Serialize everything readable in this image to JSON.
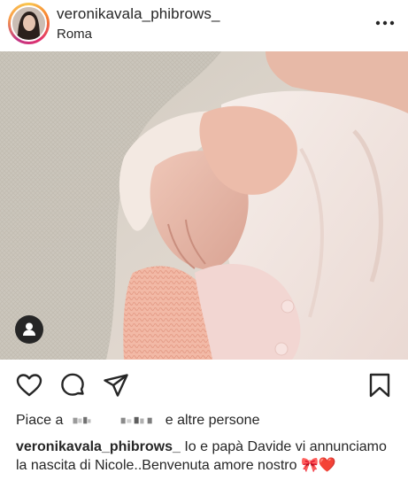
{
  "post": {
    "username": "veronikavala_phibrows_",
    "location": "Roma"
  },
  "photo": {
    "alt_icon": "user-tag-icon"
  },
  "icons": {
    "like": "heart-icon",
    "comment": "comment-icon",
    "share": "paper-plane-icon",
    "save": "bookmark-icon",
    "more": "more-options-icon"
  },
  "likes": {
    "prefix": "Piace a",
    "suffix": "e altre persone"
  },
  "caption": {
    "username": "veronikavala_phibrows_",
    "text": "Io e papà Davide vi annunciamo la nascita di Nicole..Benvenuta amore nostro 🎀❤️"
  },
  "colors": {
    "text": "#262626",
    "background": "#ffffff"
  }
}
